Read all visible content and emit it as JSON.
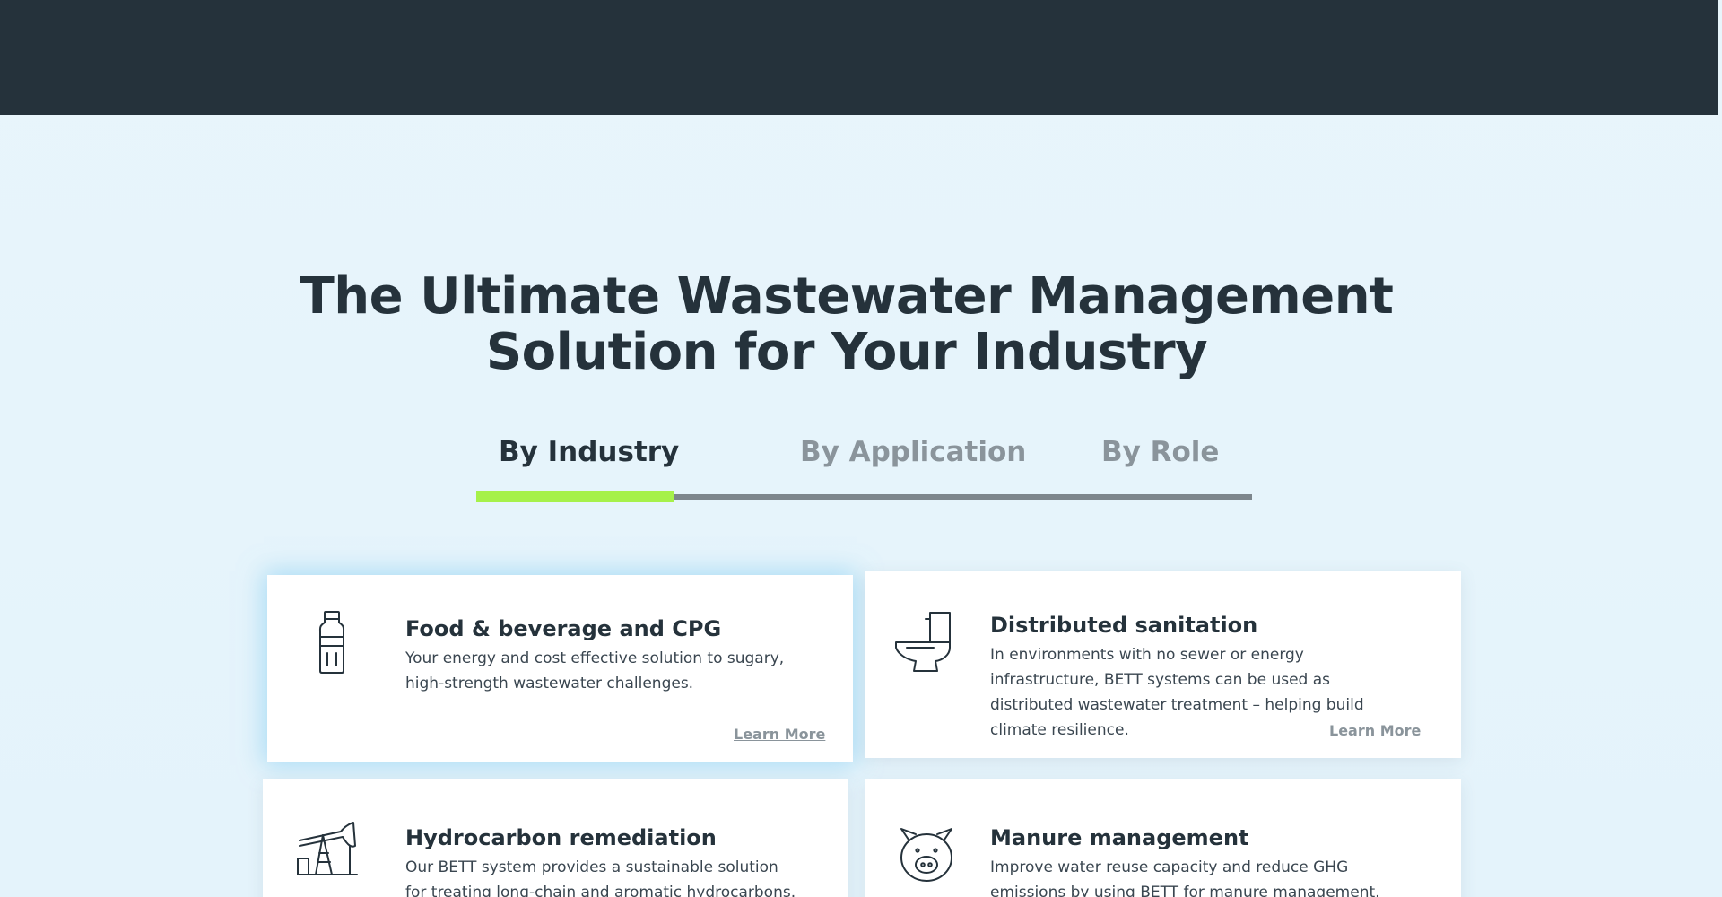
{
  "header": {
    "title_line1": "The Ultimate Wastewater Management",
    "title_line2": "Solution for Your Industry"
  },
  "tabs": [
    {
      "label": "By Industry",
      "active": true
    },
    {
      "label": "By Application",
      "active": false
    },
    {
      "label": "By Role",
      "active": false
    }
  ],
  "colors": {
    "dark": "#25323b",
    "accent": "#a6f14a",
    "muted": "#8a949b",
    "background": "#e4f3fa"
  },
  "cards": [
    {
      "icon": "bottle-icon",
      "title": "Food & beverage and CPG",
      "description": "Your energy and cost effective solution to sugary, high-strength wastewater challenges.",
      "link": "Learn More"
    },
    {
      "icon": "toilet-icon",
      "title": "Distributed sanitation",
      "description": "In environments with no sewer or energy infrastructure, BETT systems can be used as distributed wastewater treatment – helping build climate resilience.",
      "link": "Learn More"
    },
    {
      "icon": "oil-pump-icon",
      "title": "Hydrocarbon remediation",
      "description": "Our BETT system provides a sustainable solution for treating long-chain and aromatic hydrocarbons."
    },
    {
      "icon": "pig-icon",
      "title": "Manure management",
      "description": "Improve water reuse capacity and reduce GHG emissions by using BETT for manure management."
    }
  ]
}
